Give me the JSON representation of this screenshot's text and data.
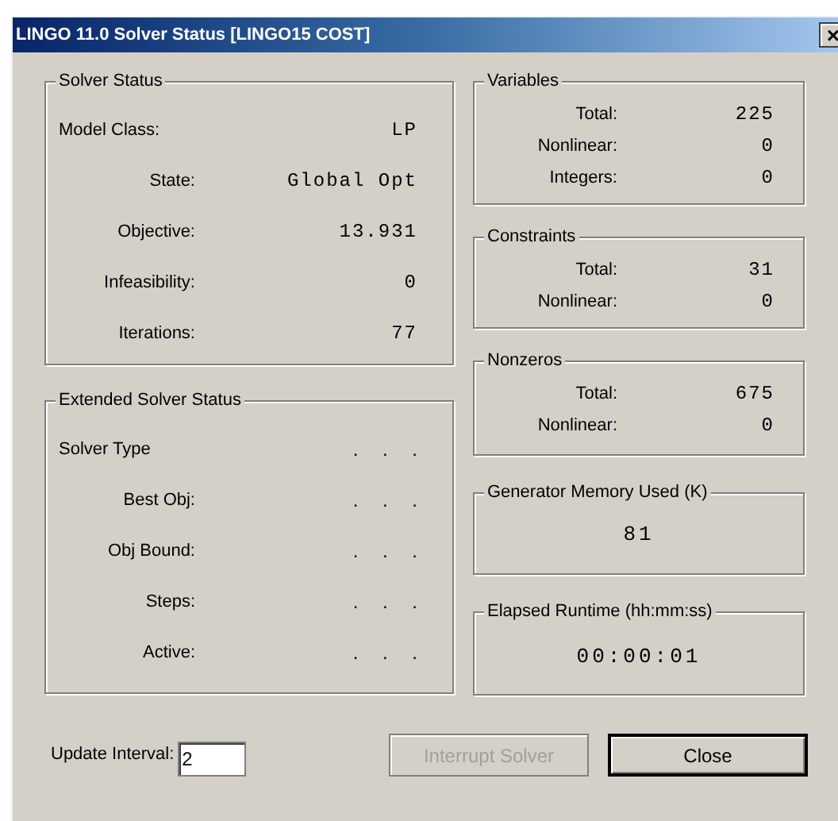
{
  "window": {
    "title": "LINGO 11.0 Solver Status [LINGO15 COST]",
    "close": "×"
  },
  "solver_status": {
    "title": "Solver Status",
    "rows": [
      {
        "label": "Model Class:",
        "value": "LP"
      },
      {
        "label": "State:",
        "value": "Global Opt"
      },
      {
        "label": "Objective:",
        "value": "13.931"
      },
      {
        "label": "Infeasibility:",
        "value": "0"
      },
      {
        "label": "Iterations:",
        "value": "77"
      }
    ]
  },
  "extended_solver_status": {
    "title": "Extended Solver Status",
    "rows": [
      {
        "label": "Solver Type",
        "value": ". . ."
      },
      {
        "label": "Best Obj:",
        "value": ". . ."
      },
      {
        "label": "Obj Bound:",
        "value": ". . ."
      },
      {
        "label": "Steps:",
        "value": ". . ."
      },
      {
        "label": "Active:",
        "value": ". . ."
      }
    ]
  },
  "variables": {
    "title": "Variables",
    "rows": [
      {
        "label": "Total:",
        "value": "225"
      },
      {
        "label": "Nonlinear:",
        "value": "0"
      },
      {
        "label": "Integers:",
        "value": "0"
      }
    ]
  },
  "constraints": {
    "title": "Constraints",
    "rows": [
      {
        "label": "Total:",
        "value": "31"
      },
      {
        "label": "Nonlinear:",
        "value": "0"
      }
    ]
  },
  "nonzeros": {
    "title": "Nonzeros",
    "rows": [
      {
        "label": "Total:",
        "value": "675"
      },
      {
        "label": "Nonlinear:",
        "value": "0"
      }
    ]
  },
  "generator_memory": {
    "title": "Generator Memory Used (K)",
    "value": "81"
  },
  "elapsed_runtime": {
    "title": "Elapsed Runtime (hh:mm:ss)",
    "value": "00:00:01"
  },
  "update_interval": {
    "label": "Update Interval:",
    "value": "2"
  },
  "buttons": [
    {
      "label": "Interrupt Solver",
      "disabled": true,
      "default": false
    },
    {
      "label": "Close",
      "disabled": false,
      "default": true
    }
  ]
}
